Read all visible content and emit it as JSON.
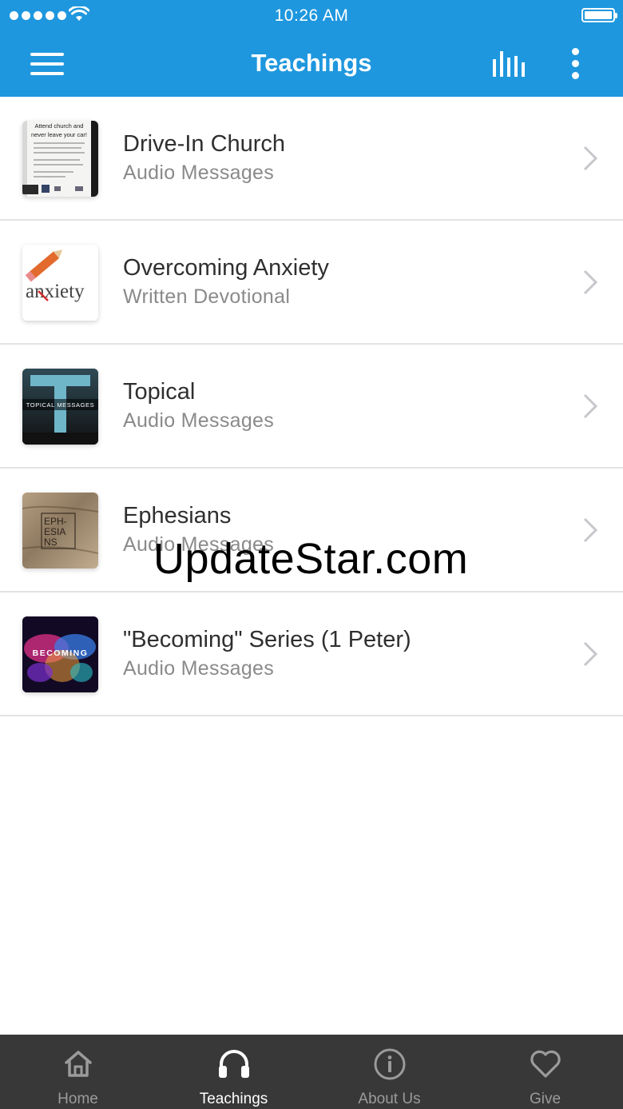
{
  "status_bar": {
    "time": "10:26 AM"
  },
  "header": {
    "title": "Teachings"
  },
  "items": [
    {
      "title": "Drive-In Church",
      "subtitle": "Audio Messages",
      "thumb_text": "Attend church and never leave your car!"
    },
    {
      "title": "Overcoming Anxiety",
      "subtitle": "Written Devotional",
      "thumb_text": "anxiety"
    },
    {
      "title": "Topical",
      "subtitle": "Audio Messages",
      "thumb_text": "TOPICAL MESSAGES"
    },
    {
      "title": "Ephesians",
      "subtitle": "Audio Messages",
      "thumb_text": "EPH-ESIA-NS"
    },
    {
      "title": "\"Becoming\" Series (1 Peter)",
      "subtitle": "Audio Messages",
      "thumb_text": "BECOMING"
    }
  ],
  "watermark": "UpdateStar.com",
  "tabs": [
    {
      "label": "Home",
      "icon": "home-icon"
    },
    {
      "label": "Teachings",
      "icon": "headphones-icon",
      "active": true
    },
    {
      "label": "About Us",
      "icon": "info-icon"
    },
    {
      "label": "Give",
      "icon": "heart-icon"
    }
  ],
  "colors": {
    "header": "#1e97de",
    "tabbar": "#383838",
    "accent": "#ffffff"
  }
}
